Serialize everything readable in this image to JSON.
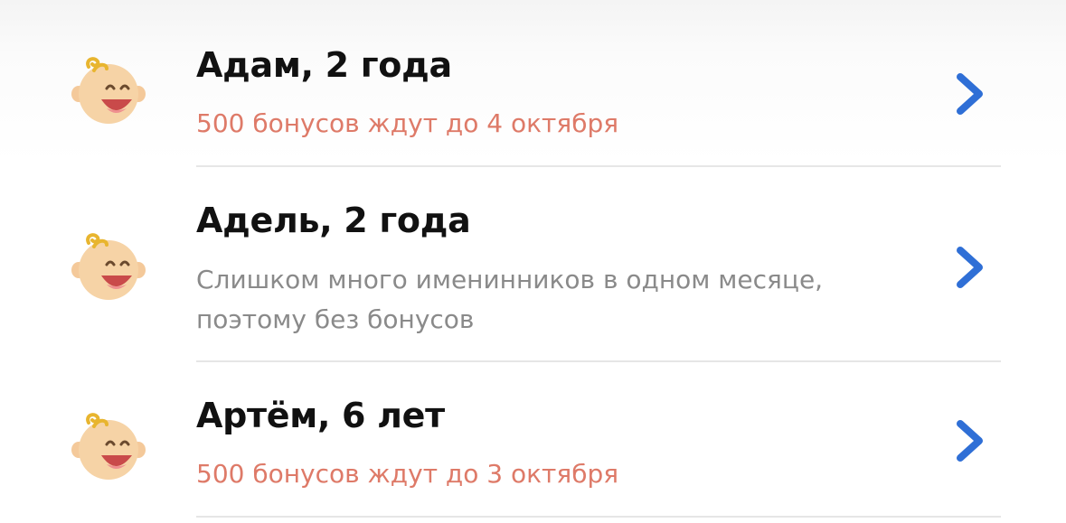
{
  "children": [
    {
      "name": "Адам, 2 года",
      "subtitle_lines": [
        "500 бонусов ждут до 4 октября"
      ],
      "status": "bonus"
    },
    {
      "name": "Адель, 2 года",
      "subtitle_lines": [
        "Слишком много именинников в одном месяце,",
        "поэтому без бонусов"
      ],
      "status": "no-bonus"
    },
    {
      "name": "Артём, 6 лет",
      "subtitle_lines": [
        "500 бонусов ждут до 3 октября"
      ],
      "status": "bonus"
    }
  ],
  "icons": {
    "avatar": "baby-face-icon",
    "chevron": "chevron-right-icon"
  },
  "colors": {
    "bonus_text": "#de7a68",
    "muted_text": "#8a8a8a",
    "chevron": "#2f6fd6",
    "divider": "#e6e6e6"
  }
}
